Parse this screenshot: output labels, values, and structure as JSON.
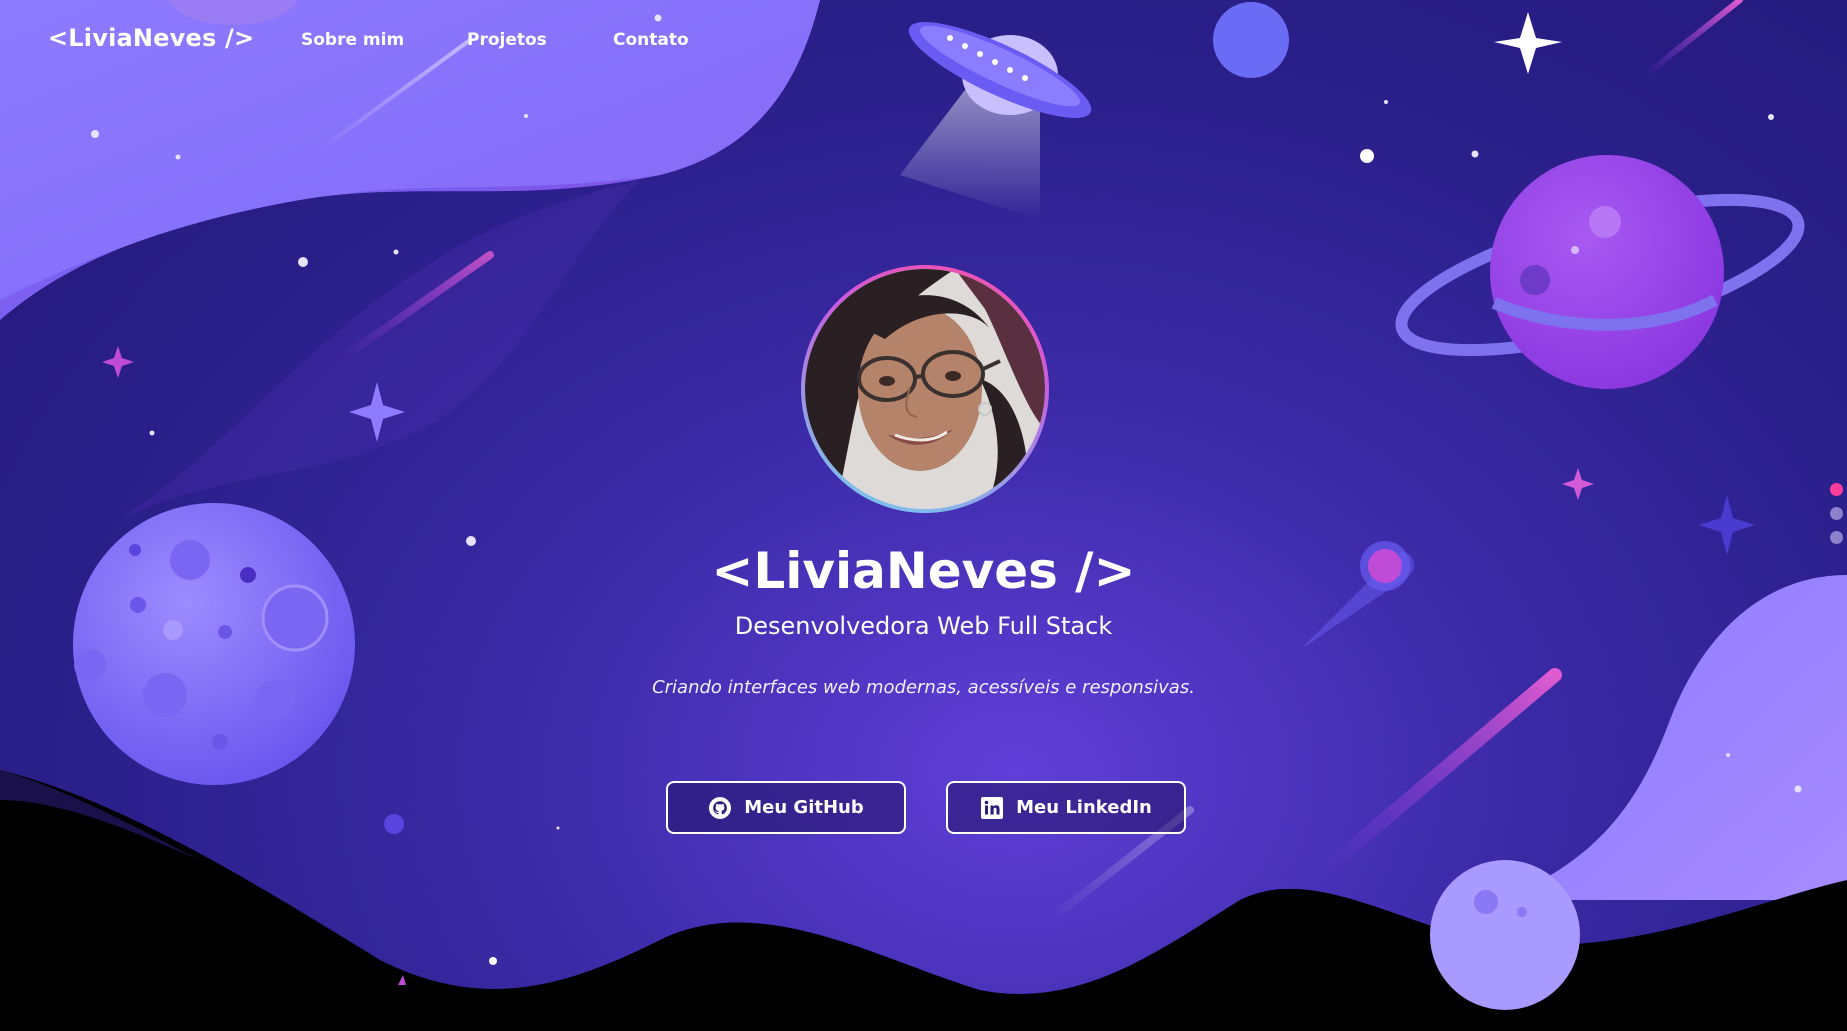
{
  "nav": {
    "logo": "<LiviaNeves />",
    "links": [
      {
        "label": "Sobre mim"
      },
      {
        "label": "Projetos"
      },
      {
        "label": "Contato"
      }
    ]
  },
  "hero": {
    "avatar_alt": "Foto de Livia Neves",
    "title": "<LiviaNeves />",
    "subtitle": "Desenvolvedora Web Full Stack",
    "tagline": "Criando interfaces web modernas, acessíveis e responsivas.",
    "buttons": [
      {
        "label": "Meu GitHub",
        "icon": "github-icon"
      },
      {
        "label": "Meu LinkedIn",
        "icon": "linkedin-icon"
      }
    ]
  },
  "slide_dots": {
    "active_index": 0,
    "count": 3,
    "active_color": "#ff3d9a",
    "inactive_color": "#8b80c9"
  },
  "colors": {
    "background_deep": "#2b1f8a",
    "accent_purple": "#8b5cf6",
    "accent_pink": "#ff3d9a",
    "bottom_wave": "#000000"
  }
}
